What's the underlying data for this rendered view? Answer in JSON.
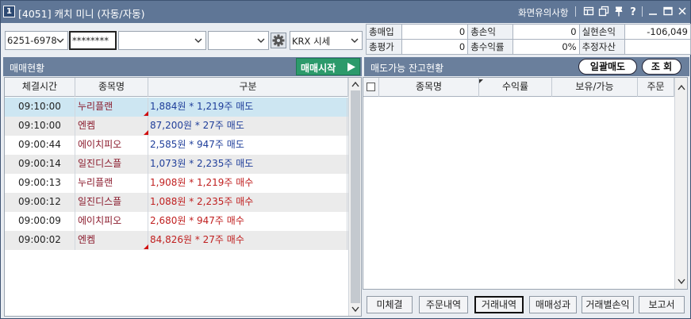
{
  "window": {
    "screen_no": "1",
    "title": "[4051] 캐치 미니 (자동/자동)",
    "notice_link": "화면유의사항"
  },
  "controls": {
    "account": "6251-6978",
    "password": "********",
    "select3": "",
    "select4": "",
    "market": "KRX 시세"
  },
  "summary": {
    "rows": [
      [
        {
          "label": "총매입",
          "value": "0"
        },
        {
          "label": "총손익",
          "value": "0"
        },
        {
          "label": "실현손익",
          "value": "-106,049"
        }
      ],
      [
        {
          "label": "총평가",
          "value": "0"
        },
        {
          "label": "총수익률",
          "value": "0%"
        },
        {
          "label": "추정자산",
          "value": ""
        }
      ]
    ]
  },
  "left_panel": {
    "title": "매매현황",
    "start_button": "매매시작",
    "columns": [
      "체결시간",
      "종목명",
      "구분"
    ],
    "rows": [
      {
        "time": "09:10:00",
        "name": "누리플랜",
        "detail": "1,884원 * 1,219주 매도",
        "type": "sell",
        "flag": true
      },
      {
        "time": "09:10:00",
        "name": "엔켐",
        "detail": "87,200원 * 27주 매도",
        "type": "sell",
        "flag": true
      },
      {
        "time": "09:00:44",
        "name": "에이치피오",
        "detail": "2,585원 * 947주 매도",
        "type": "sell",
        "flag": false
      },
      {
        "time": "09:00:14",
        "name": "일진디스플",
        "detail": "1,073원 * 2,235주 매도",
        "type": "sell",
        "flag": false
      },
      {
        "time": "09:00:13",
        "name": "누리플랜",
        "detail": "1,908원 * 1,219주 매수",
        "type": "buy",
        "flag": false
      },
      {
        "time": "09:00:12",
        "name": "일진디스플",
        "detail": "1,088원 * 2,235주 매수",
        "type": "buy",
        "flag": false
      },
      {
        "time": "09:00:09",
        "name": "에이치피오",
        "detail": "2,680원 * 947주 매수",
        "type": "buy",
        "flag": false
      },
      {
        "time": "09:00:02",
        "name": "엔켐",
        "detail": "84,826원 * 27주 매수",
        "type": "buy",
        "flag": true
      }
    ]
  },
  "right_panel": {
    "title": "매도가능 잔고현황",
    "bulk_sell_button": "일괄매도",
    "query_button": "조 회",
    "columns": [
      "종목명",
      "수익률",
      "보유/가능",
      "주문"
    ]
  },
  "bottom_buttons": [
    "미체결",
    "주문내역",
    "거래내역",
    "매매성과",
    "거래별손익",
    "보고서"
  ],
  "colors": {
    "sell": "#1f3e9a",
    "buy": "#c02020",
    "start_button": "#2c9a6b",
    "header": "#6a7f9c"
  }
}
